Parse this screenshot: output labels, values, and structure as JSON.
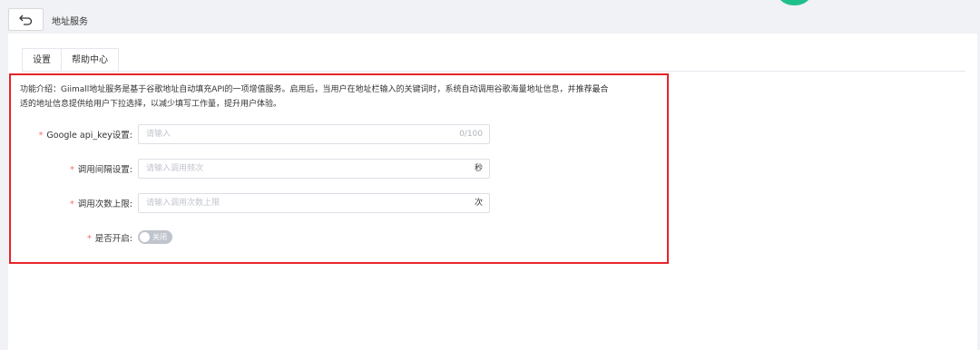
{
  "header": {
    "title": "地址服务"
  },
  "tabs": [
    {
      "label": "设置"
    },
    {
      "label": "帮助中心"
    }
  ],
  "description": {
    "line1": "功能介绍：Giimall地址服务是基于谷歌地址自动填充API的一项增值服务。启用后，当用户在地址栏输入的关键词时，系统自动调用谷歌海量地址信息，并推荐最合",
    "line2": "适的地址信息提供给用户下拉选择，以减少填写工作量，提升用户体验。"
  },
  "form": {
    "required_mark": "*",
    "api_key": {
      "label": "Google api_key设置:",
      "placeholder": "请输入",
      "count": "0/100"
    },
    "interval": {
      "label": "调用间隔设置:",
      "placeholder": "请输入调用频次",
      "suffix": "秒"
    },
    "limit": {
      "label": "调用次数上限:",
      "placeholder": "请输入调用次数上限",
      "suffix": "次"
    },
    "enable": {
      "label": "是否开启:",
      "switch_text": "关闭"
    }
  },
  "colors": {
    "highlight_box": "#e62429",
    "accent_green": "#1fbf89"
  }
}
